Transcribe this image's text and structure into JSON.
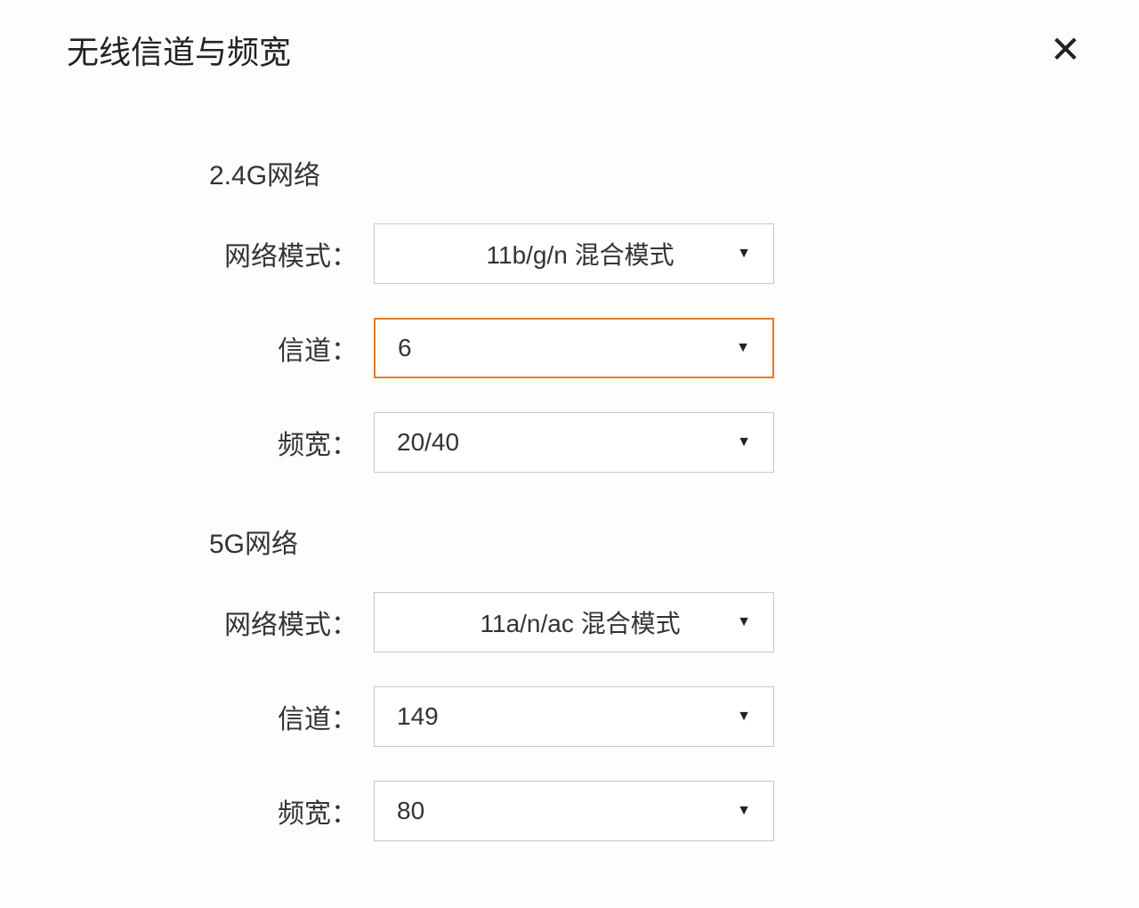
{
  "header": {
    "title": "无线信道与频宽"
  },
  "section_2g": {
    "title": "2.4G网络",
    "mode_label": "网络模式：",
    "mode_value": "11b/g/n 混合模式",
    "channel_label": "信道：",
    "channel_value": "6",
    "bandwidth_label": "频宽：",
    "bandwidth_value": "20/40"
  },
  "section_5g": {
    "title": "5G网络",
    "mode_label": "网络模式：",
    "mode_value": "11a/n/ac 混合模式",
    "channel_label": "信道：",
    "channel_value": "149",
    "bandwidth_label": "频宽：",
    "bandwidth_value": "80"
  }
}
